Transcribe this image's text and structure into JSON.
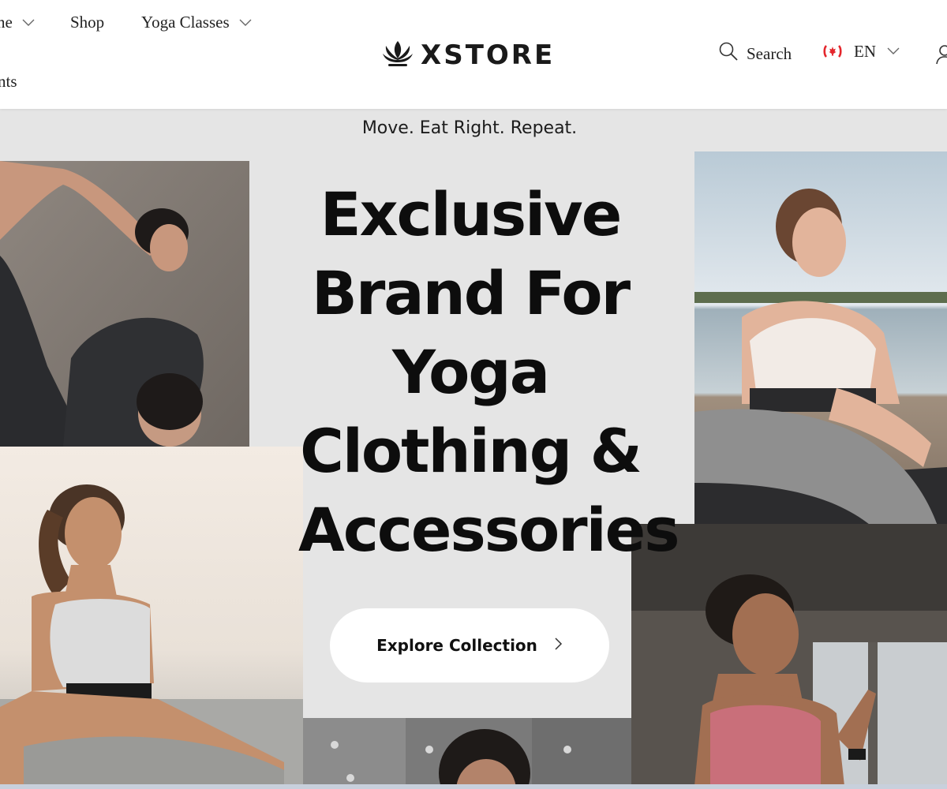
{
  "header": {
    "nav": [
      {
        "label": "ne",
        "has_dropdown": true
      },
      {
        "label": "Shop",
        "has_dropdown": false
      },
      {
        "label": "Yoga Classes",
        "has_dropdown": true
      },
      {
        "label": "nts",
        "has_dropdown": false
      }
    ],
    "logo_text": "XSTORE",
    "logo_icon": "lotus-icon",
    "search_label": "Search",
    "language": "EN",
    "flag_icon": "canada-flag-icon",
    "account_icon": "user-icon"
  },
  "hero": {
    "tagline": "Move. Eat Right. Repeat.",
    "headline": [
      "Exclusive",
      "Brand For",
      "Yoga",
      "Clothing &",
      "Accessories"
    ],
    "cta_label": "Explore Collection",
    "cta_icon": "chevron-right-icon"
  },
  "images": [
    "yoga-dancer-pose-photo",
    "yoga-meditation-photo",
    "yoga-seated-stretch-photo",
    "yoga-prayer-hands-photo",
    "yoga-portrait-photo"
  ],
  "colors": {
    "page_background": "#e5e5e5",
    "header_background": "#ffffff",
    "text": "#111111",
    "flag_red": "#e4262c"
  }
}
